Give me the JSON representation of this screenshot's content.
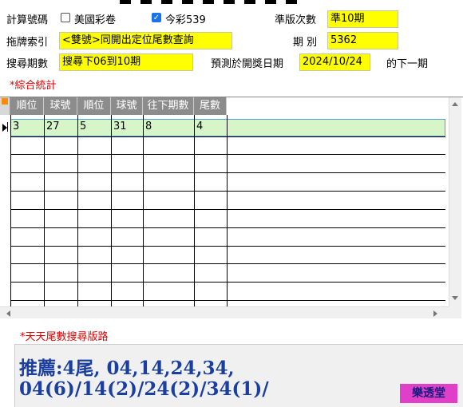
{
  "row1": {
    "calc_label": "計算號碼",
    "opt_us_label": "美國彩卷",
    "opt_us_checked": false,
    "opt_539_label": "今彩539",
    "opt_539_checked": true,
    "period_label": "準版次數",
    "period_value": "準10期"
  },
  "row2": {
    "index_label": "拖牌索引",
    "index_value": "<雙號>同開出定位尾數查詢",
    "issue_label": "期 別",
    "issue_value": "5362"
  },
  "row3": {
    "search_label": "搜尋期數",
    "search_value": "搜尋下06到10期",
    "predict_label": "預測於開獎日期",
    "predict_date": "2024/10/24",
    "next_label": "的下一期"
  },
  "stats_label": "*綜合統計",
  "table": {
    "headers": [
      "順位",
      "球號",
      "順位",
      "球號",
      "往下期數",
      "尾數"
    ],
    "rows": [
      [
        "3",
        "27",
        "5",
        "31",
        "8",
        "4"
      ]
    ]
  },
  "route_label": "*天天尾數搜尋版路",
  "recommend_line1": "推薦:4尾, 04,14,24,34,",
  "recommend_line2": "04(6)/14(2)/24(2)/34(1)/",
  "brand": "樂透堂"
}
